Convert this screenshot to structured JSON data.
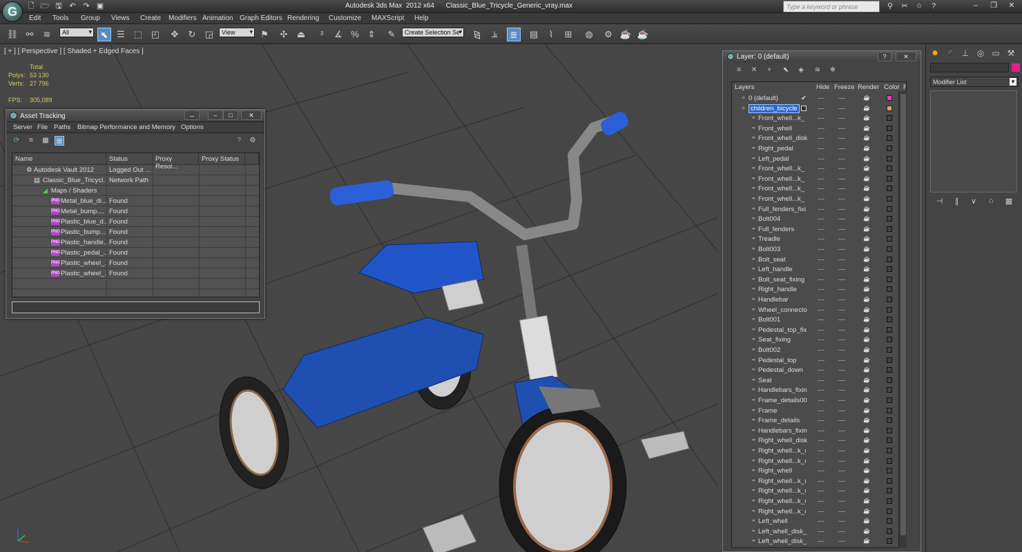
{
  "app": {
    "window_title": "Autodesk 3ds Max  2012 x64      Classic_Blue_Tricycle_Generic_vray.max",
    "search_placeholder": "Type a keyword or phrase"
  },
  "menu": [
    "Edit",
    "Tools",
    "Group",
    "Views",
    "Create",
    "Modifiers",
    "Animation",
    "Graph Editors",
    "Rendering",
    "Customize",
    "MAXScript",
    "Help"
  ],
  "toolbar": {
    "selection_filter": "All",
    "reference_coord": "View",
    "named_selection": "Create Selection Se"
  },
  "viewport": {
    "label": "[ + ] [ Perspective ] [ Shaded + Edged Faces ]",
    "stats": {
      "total_label": "Total",
      "polys_label": "Polys:",
      "polys_value": "53 130",
      "verts_label": "Verts:",
      "verts_value": "27 796",
      "fps_label": "FPS:",
      "fps_value": "305,089"
    }
  },
  "asset_tracking": {
    "title": "Asset Tracking",
    "menu": [
      "Server",
      "File",
      "Paths",
      "Bitmap Performance and Memory",
      "Options"
    ],
    "columns": [
      "Name",
      "Status",
      "Proxy Resol...",
      "Proxy Status"
    ],
    "rows": [
      {
        "name": "Autodesk Vault 2012",
        "status": "Logged Out ...",
        "icon": "vault-icon"
      },
      {
        "name": "Classic_Blue_Tricycl...",
        "status": "Network Path",
        "icon": "max-file-icon"
      },
      {
        "name": "Maps / Shaders",
        "status": "",
        "icon": "maps-icon"
      },
      {
        "name": "Metal_blue_di...",
        "status": "Found",
        "icon": "png-icon"
      },
      {
        "name": "Metal_bump....",
        "status": "Found",
        "icon": "png-icon"
      },
      {
        "name": "Plastic_blue_d...",
        "status": "Found",
        "icon": "png-icon"
      },
      {
        "name": "Plastic_bump....",
        "status": "Found",
        "icon": "png-icon"
      },
      {
        "name": "Plastic_handle...",
        "status": "Found",
        "icon": "png-icon"
      },
      {
        "name": "Plastic_pedal_...",
        "status": "Found",
        "icon": "png-icon"
      },
      {
        "name": "Plastic_wheel_...",
        "status": "Found",
        "icon": "png-icon"
      },
      {
        "name": "Plastic_wheel_...",
        "status": "Found",
        "icon": "png-icon"
      }
    ],
    "png_badge": "PNG"
  },
  "layer_panel": {
    "title": "Layer: 0 (default)",
    "columns": [
      "Layers",
      "Hide",
      "Freeze",
      "Render",
      "Color",
      "R"
    ],
    "layers": [
      {
        "name": "0 (default)",
        "swatch": "#e040d0",
        "check": "✔"
      },
      {
        "name": "children_bicycle",
        "swatch": "#e8a070"
      }
    ],
    "objects": [
      "Front_whell...k_",
      "Front_whell",
      "Front_whell_disk",
      "Right_pedal",
      "Left_pedal",
      "Front_whell...k_",
      "Front_whell...k_",
      "Front_whell...k_",
      "Front_whell...k_",
      "Full_fenders_fixi",
      "Bolt004",
      "Full_fenders",
      "Treadle",
      "Bolt003",
      "Bolt_seat",
      "Left_handle",
      "Bolt_seat_fixing",
      "Right_handle",
      "Handlebar",
      "Wheel_connecto",
      "Bolt001",
      "Pedestal_top_fix",
      "Seat_fixing",
      "Bolt002",
      "Pedestal_top",
      "Pedestal_down",
      "Seat",
      "Handlebars_fixin",
      "Frame_details00",
      "Frame",
      "Frame_details",
      "Handlebars_fixin",
      "Right_whell_disk",
      "Right_whell...k_ı",
      "Right_whell...k_ı",
      "Right_whell",
      "Right_whell...k_ı",
      "Right_whell...k_ı",
      "Right_whell...k_ı",
      "Right_whell...k_ı",
      "Left_whell",
      "Left_whell_disk_",
      "Left_whell_disk_"
    ]
  },
  "command_panel": {
    "modifier_list": "Modifier List",
    "object_color": "#e0208f"
  }
}
